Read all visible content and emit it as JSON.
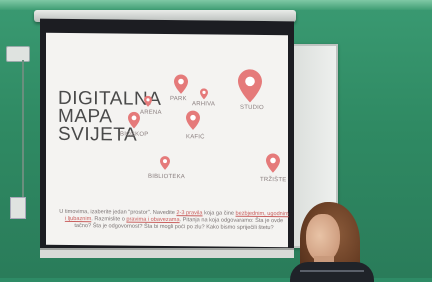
{
  "slide": {
    "title_lines": [
      "DIGITALNA",
      "MAPA",
      "SVIJETA"
    ],
    "locations": [
      "ARENA",
      "PARK",
      "ARHIVA",
      "STUDIO",
      "BIOSKOP",
      "KAFIĆ",
      "BIBLIOTEKA",
      "TRŽIŠTE"
    ],
    "instructions": {
      "part1": "U timovima, izaberite jedan \"prostor\". Navedite ",
      "highlight1": "2-3 pravila",
      "part2": " koja ga čine ",
      "highlight2": "bezbjednim, ugodnim i ljubaznim",
      "part3": ". Razmislite o ",
      "highlight3": "pravima i obavezama",
      "part4": ". Pitanja na koja odgovaramo: Šta je ovde tačno? Šta je odgovornost? Šta bi mogli poći po zlu? Kako bismo spriječili štetu?"
    },
    "pin_color": "#e57a7a"
  }
}
